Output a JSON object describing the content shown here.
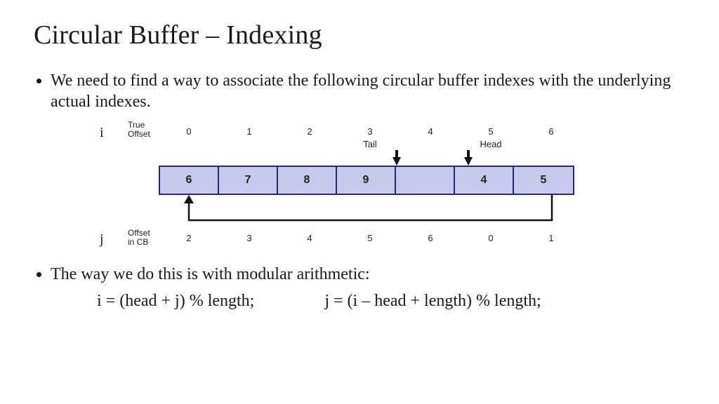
{
  "title": "Circular Buffer – Indexing",
  "bullet1": "We need to find a way to associate the following circular buffer indexes with the underlying actual indexes.",
  "bullet2": "The way we do this is with modular arithmetic:",
  "formula_i": "i = (head + j) % length;",
  "formula_j": "j = (i – head + length) % length;",
  "diagram": {
    "i_symbol": "i",
    "j_symbol": "j",
    "true_offset_label": "True\nOffset",
    "offset_cb_label": "Offset\nin CB",
    "true_offsets": [
      "0",
      "1",
      "2",
      "3",
      "4",
      "5",
      "6"
    ],
    "cb_offsets": [
      "2",
      "3",
      "4",
      "5",
      "6",
      "0",
      "1"
    ],
    "tail_label": "Tail",
    "head_label": "Head",
    "cells": [
      "6",
      "7",
      "8",
      "9",
      "",
      "4",
      "5"
    ],
    "tail_index": 3,
    "head_index": 5
  },
  "chart_data": {
    "type": "table",
    "title": "Circular buffer index mapping",
    "columns": [
      "true_offset_i",
      "cell_value",
      "cb_offset_j"
    ],
    "rows": [
      [
        0,
        6,
        2
      ],
      [
        1,
        7,
        3
      ],
      [
        2,
        8,
        4
      ],
      [
        3,
        9,
        5
      ],
      [
        4,
        null,
        6
      ],
      [
        5,
        4,
        0
      ],
      [
        6,
        5,
        1
      ]
    ],
    "markers": {
      "tail_at_i": 3,
      "head_at_i": 5
    },
    "formulas": {
      "i": "i = (head + j) % length",
      "j": "j = (i - head + length) % length"
    }
  }
}
